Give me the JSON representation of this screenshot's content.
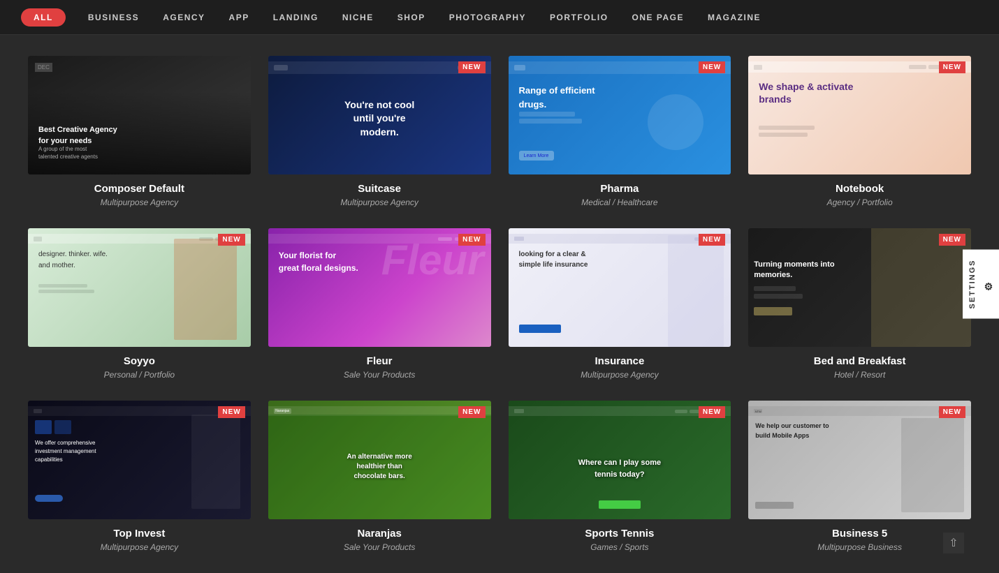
{
  "nav": {
    "items": [
      {
        "label": "ALL",
        "active": true
      },
      {
        "label": "BUSINESS",
        "active": false
      },
      {
        "label": "AGENCY",
        "active": false
      },
      {
        "label": "APP",
        "active": false
      },
      {
        "label": "LANDING",
        "active": false
      },
      {
        "label": "NICHE",
        "active": false
      },
      {
        "label": "SHOP",
        "active": false
      },
      {
        "label": "PHOTOGRAPHY",
        "active": false
      },
      {
        "label": "PORTFOLIO",
        "active": false
      },
      {
        "label": "ONE PAGE",
        "active": false
      },
      {
        "label": "MAGAZINE",
        "active": false
      }
    ]
  },
  "cards": [
    {
      "title": "Composer Default",
      "subtitle": "Multipurpose Agency",
      "badge": "",
      "bg": "composer"
    },
    {
      "title": "Suitcase",
      "subtitle": "Multipurpose Agency",
      "badge": "NEW",
      "bg": "suitcase"
    },
    {
      "title": "Pharma",
      "subtitle": "Medical / Healthcare",
      "badge": "NEW",
      "bg": "pharma"
    },
    {
      "title": "Notebook",
      "subtitle": "Agency / Portfolio",
      "badge": "NEW",
      "bg": "notebook"
    },
    {
      "title": "Soyyo",
      "subtitle": "Personal / Portfolio",
      "badge": "NEW",
      "bg": "soyyo"
    },
    {
      "title": "Fleur",
      "subtitle": "Sale Your Products",
      "badge": "NEW",
      "bg": "fleur"
    },
    {
      "title": "Insurance",
      "subtitle": "Multipurpose Agency",
      "badge": "NEW",
      "bg": "insurance"
    },
    {
      "title": "Bed and Breakfast",
      "subtitle": "Hotel / Resort",
      "badge": "NEW",
      "bg": "bnb"
    },
    {
      "title": "Top Invest",
      "subtitle": "Multipurpose Agency",
      "badge": "NEW",
      "bg": "topinvest"
    },
    {
      "title": "Naranjas",
      "subtitle": "Sale Your Products",
      "badge": "NEW",
      "bg": "naranjas"
    },
    {
      "title": "Sports Tennis",
      "subtitle": "Games / Sports",
      "badge": "NEW",
      "bg": "tennis"
    },
    {
      "title": "Business 5",
      "subtitle": "Multipurpose Business",
      "badge": "NEW",
      "bg": "business5"
    }
  ],
  "settings": {
    "label": "SETTINGS"
  },
  "badge_new": "NEW"
}
